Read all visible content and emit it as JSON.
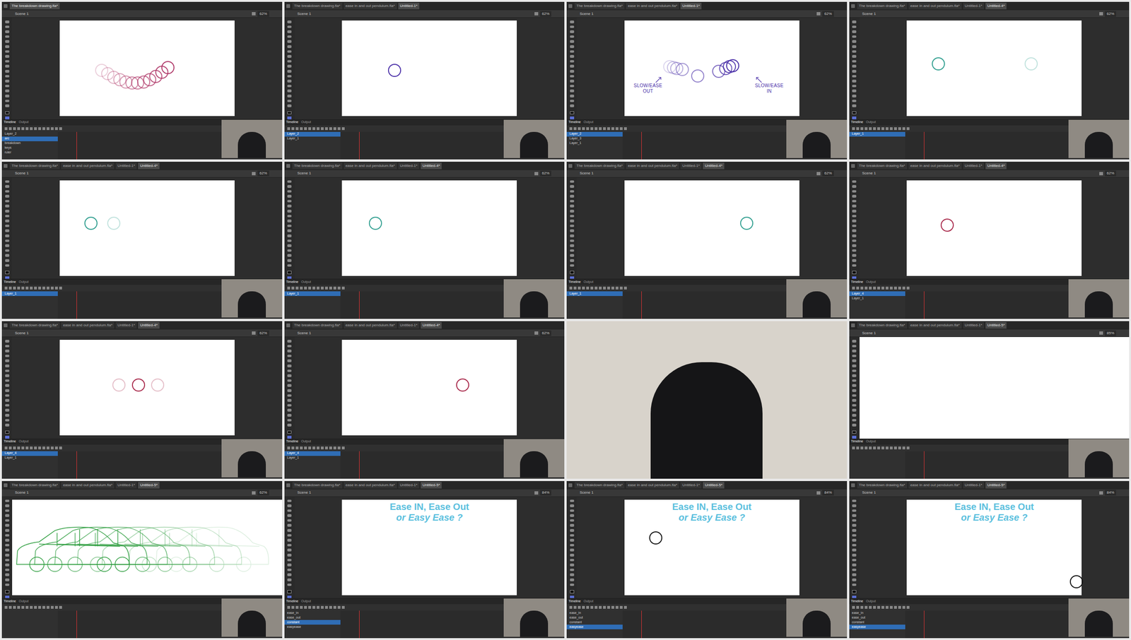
{
  "timeline_tabs": [
    "Timeline",
    "Output"
  ],
  "frames": [
    {
      "kind": "app",
      "tabs": [
        "The breakdown drawing.fla*"
      ],
      "scene": "Scene 1",
      "zoom": "62%",
      "stroke": "#b03a6a",
      "layers": [
        {
          "name": "Layer_2",
          "selected": false
        },
        {
          "name": "arc",
          "selected": true
        },
        {
          "name": "breakdown",
          "selected": false
        },
        {
          "name": "keys",
          "selected": false
        },
        {
          "name": "ruler",
          "selected": false
        }
      ],
      "notes": [],
      "heading": []
    },
    {
      "kind": "app",
      "tabs": [
        "The breakdown drawing.fla*",
        "ease in and out pendulum.fla*",
        "Untitled-1*"
      ],
      "scene": "Scene 1",
      "zoom": "62%",
      "stroke": "#4a2fa8",
      "layers": [
        {
          "name": "Layer_2",
          "selected": true
        },
        {
          "name": "Layer_1",
          "selected": false
        }
      ],
      "notes": [],
      "heading": []
    },
    {
      "kind": "app",
      "tabs": [
        "The breakdown drawing.fla*",
        "ease in and out pendulum.fla*",
        "Untitled-1*"
      ],
      "scene": "Scene 1",
      "zoom": "62%",
      "stroke": "#4a2fa8",
      "layers": [
        {
          "name": "Layer_2",
          "selected": true
        },
        {
          "name": "Layer_3",
          "selected": false
        },
        {
          "name": "Layer_1",
          "selected": false
        }
      ],
      "notes": [
        [
          "SLOW/EASE",
          "OUT"
        ],
        [
          "SLOW/EASE",
          "IN"
        ]
      ],
      "heading": []
    },
    {
      "kind": "app",
      "tabs": [
        "The breakdown drawing.fla*",
        "ease in and out pendulum.fla*",
        "Untitled-1*",
        "Untitled-4*"
      ],
      "scene": "Scene 1",
      "zoom": "62%",
      "stroke": "#2f9e8f",
      "layers": [
        {
          "name": "Layer_1",
          "selected": true
        }
      ],
      "notes": [],
      "heading": []
    },
    {
      "kind": "app",
      "tabs": [
        "The breakdown drawing.fla*",
        "ease in and out pendulum.fla*",
        "Untitled-1*",
        "Untitled-4*"
      ],
      "scene": "Scene 1",
      "zoom": "62%",
      "stroke": "#2f9e8f",
      "layers": [
        {
          "name": "Layer_1",
          "selected": true
        }
      ],
      "notes": [],
      "heading": []
    },
    {
      "kind": "app",
      "tabs": [
        "The breakdown drawing.fla*",
        "ease in and out pendulum.fla*",
        "Untitled-1*",
        "Untitled-4*"
      ],
      "scene": "Scene 1",
      "zoom": "62%",
      "stroke": "#2f9e8f",
      "layers": [
        {
          "name": "Layer_1",
          "selected": true
        }
      ],
      "notes": [],
      "heading": []
    },
    {
      "kind": "app",
      "tabs": [
        "The breakdown drawing.fla*",
        "ease in and out pendulum.fla*",
        "Untitled-1*",
        "Untitled-4*"
      ],
      "scene": "Scene 1",
      "zoom": "62%",
      "stroke": "#2f9e8f",
      "layers": [
        {
          "name": "Layer_1",
          "selected": true
        }
      ],
      "notes": [],
      "heading": []
    },
    {
      "kind": "app",
      "tabs": [
        "The breakdown drawing.fla*",
        "ease in and out pendulum.fla*",
        "Untitled-1*",
        "Untitled-4*"
      ],
      "scene": "Scene 1",
      "zoom": "62%",
      "stroke": "#a8284a",
      "layers": [
        {
          "name": "Layer_4",
          "selected": true
        },
        {
          "name": "Layer_1",
          "selected": false
        }
      ],
      "notes": [],
      "heading": []
    },
    {
      "kind": "app",
      "tabs": [
        "The breakdown drawing.fla*",
        "ease in and out pendulum.fla*",
        "Untitled-1*",
        "Untitled-4*"
      ],
      "scene": "Scene 1",
      "zoom": "62%",
      "stroke": "#a8284a",
      "layers": [
        {
          "name": "Layer_4",
          "selected": true
        },
        {
          "name": "Layer_1",
          "selected": false
        }
      ],
      "notes": [],
      "heading": []
    },
    {
      "kind": "app",
      "tabs": [
        "The breakdown drawing.fla*",
        "ease in and out pendulum.fla*",
        "Untitled-1*",
        "Untitled-4*"
      ],
      "scene": "Scene 1",
      "zoom": "62%",
      "stroke": "#a8284a",
      "layers": [
        {
          "name": "Layer_4",
          "selected": true
        },
        {
          "name": "Layer_1",
          "selected": false
        }
      ],
      "notes": [],
      "heading": []
    },
    {
      "kind": "photo"
    },
    {
      "kind": "blank",
      "tabs": [
        "The breakdown drawing.fla*",
        "ease in and out pendulum.fla*",
        "Untitled-1*",
        "Untitled-5*"
      ],
      "scene": "Scene 1",
      "zoom": "85%",
      "layers": []
    },
    {
      "kind": "car",
      "tabs": [
        "The breakdown drawing.fla*",
        "ease in and out pendulum.fla*",
        "Untitled-1*",
        "Untitled-5*"
      ],
      "scene": "Scene 1",
      "zoom": "62%",
      "stroke": "#2e9e3f",
      "layers": []
    },
    {
      "kind": "app",
      "tabs": [
        "The breakdown drawing.fla*",
        "ease in and out pendulum.fla*",
        "Untitled-1*",
        "Untitled-5*"
      ],
      "scene": "Scene 1",
      "zoom": "84%",
      "stroke": "#111111",
      "layers": [
        {
          "name": "ease_in",
          "selected": false
        },
        {
          "name": "ease_out",
          "selected": false
        },
        {
          "name": "constant",
          "selected": true
        },
        {
          "name": "easyease",
          "selected": false
        }
      ],
      "notes": [],
      "heading": [
        "Ease IN, Ease Out",
        "or Easy Ease ?"
      ]
    },
    {
      "kind": "app",
      "tabs": [
        "The breakdown drawing.fla*",
        "ease in and out pendulum.fla*",
        "Untitled-1*",
        "Untitled-5*"
      ],
      "scene": "Scene 1",
      "zoom": "84%",
      "stroke": "#111111",
      "layers": [
        {
          "name": "ease_in",
          "selected": false
        },
        {
          "name": "ease_out",
          "selected": false
        },
        {
          "name": "constant",
          "selected": false
        },
        {
          "name": "easyease",
          "selected": true
        }
      ],
      "notes": [],
      "heading": [
        "Ease IN, Ease Out",
        "or Easy Ease ?"
      ]
    },
    {
      "kind": "app",
      "tabs": [
        "The breakdown drawing.fla*",
        "ease in and out pendulum.fla*",
        "Untitled-1*",
        "Untitled-5*"
      ],
      "scene": "Scene 1",
      "zoom": "84%",
      "stroke": "#111111",
      "layers": [
        {
          "name": "ease_in",
          "selected": false
        },
        {
          "name": "ease_out",
          "selected": false
        },
        {
          "name": "constant",
          "selected": false
        },
        {
          "name": "easyease",
          "selected": true
        }
      ],
      "notes": [],
      "heading": [
        "Ease IN, Ease Out",
        "or Easy Ease ?"
      ]
    }
  ]
}
